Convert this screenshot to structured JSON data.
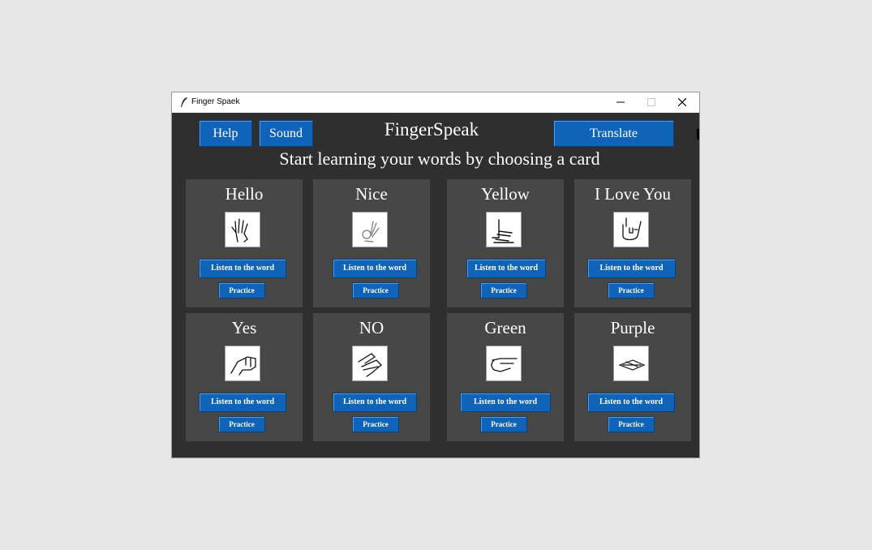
{
  "window": {
    "title": "Finger Spaek",
    "controls": {
      "minimize": "minimize-icon",
      "maximize": "maximize-icon",
      "close": "close-icon"
    }
  },
  "header": {
    "help_label": "Help",
    "sound_label": "Sound",
    "app_title": "FingerSpeak",
    "translate_label": "Translate",
    "subtitle": "Start learning your words by choosing a card"
  },
  "colors": {
    "window_bg": "#2f2f2f",
    "card_bg": "#474747",
    "button_blue": "#0f63b8",
    "text": "#ffffff"
  },
  "cards": [
    {
      "word": "Hello",
      "icon": "open-hand-icon",
      "listen_label": "Listen to the word",
      "practice_label": "Practice"
    },
    {
      "word": "Nice",
      "icon": "ok-hand-icon",
      "listen_label": "Listen to the word",
      "practice_label": "Practice"
    },
    {
      "word": "Yellow",
      "icon": "thumb-pinky-hand-icon",
      "listen_label": "Listen to the word",
      "practice_label": "Practice"
    },
    {
      "word": "I Love You",
      "icon": "i-love-you-hand-icon",
      "listen_label": "Listen to the word",
      "practice_label": "Practice"
    },
    {
      "word": "Yes",
      "icon": "fist-hand-icon",
      "listen_label": "Listen to the word",
      "practice_label": "Practice"
    },
    {
      "word": "NO",
      "icon": "no-hand-icon",
      "listen_label": "Listen to the word",
      "practice_label": "Practice"
    },
    {
      "word": "Green",
      "icon": "pointing-hand-icon",
      "listen_label": "Listen to the word",
      "practice_label": "Practice"
    },
    {
      "word": "Purple",
      "icon": "flat-hand-icon",
      "listen_label": "Listen to the word",
      "practice_label": "Practice"
    }
  ]
}
